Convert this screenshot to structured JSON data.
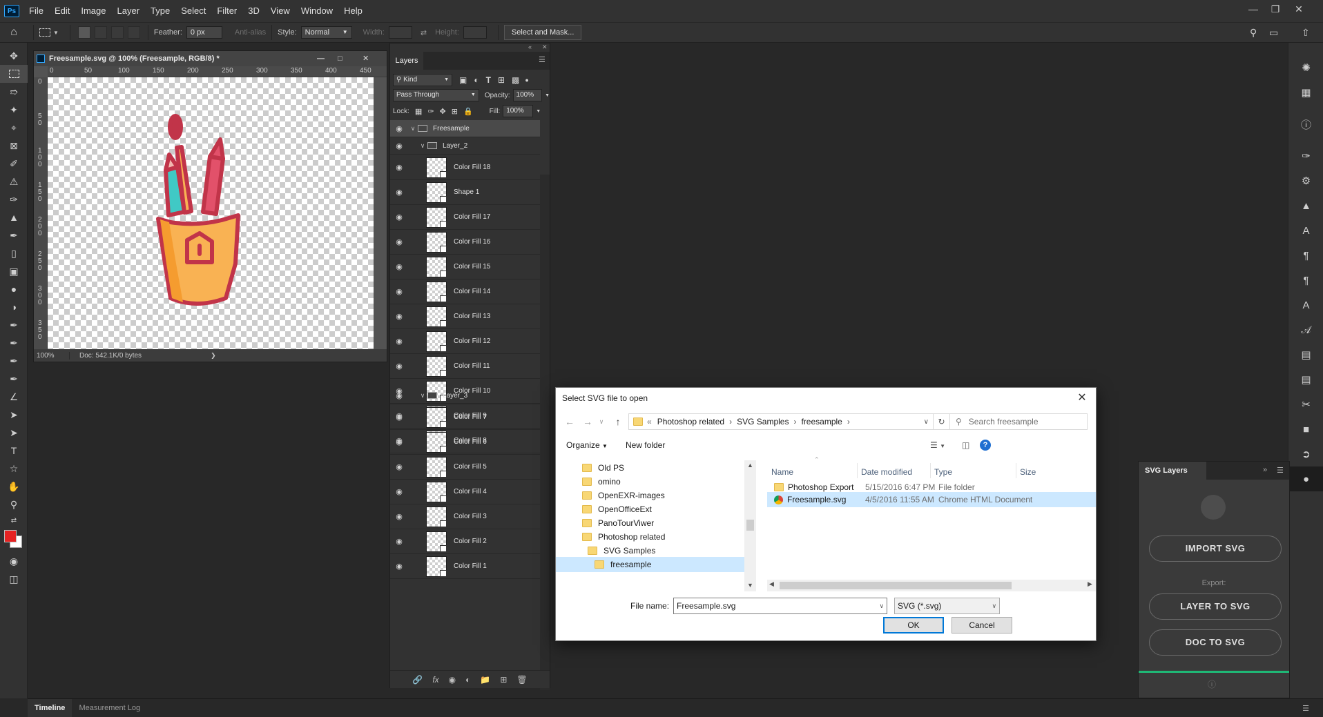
{
  "app": {
    "logo": "Ps",
    "menu": [
      "File",
      "Edit",
      "Image",
      "Layer",
      "Type",
      "Select",
      "Filter",
      "3D",
      "View",
      "Window",
      "Help"
    ]
  },
  "options": {
    "feather_label": "Feather:",
    "feather_value": "0 px",
    "antialias_label": "Anti-alias",
    "style_label": "Style:",
    "style_value": "Normal",
    "width_label": "Width:",
    "height_label": "Height:",
    "select_mask_label": "Select and Mask..."
  },
  "document": {
    "title": "Freesample.svg @ 100% (Freesample, RGB/8) *",
    "ruler_h": [
      "0",
      "50",
      "100",
      "150",
      "200",
      "250",
      "300",
      "350",
      "400",
      "450"
    ],
    "ruler_v": [
      "0",
      "5\n0",
      "1\n0\n0",
      "1\n5\n0",
      "2\n0\n0",
      "2\n5\n0",
      "3\n0\n0",
      "3\n5\n0"
    ],
    "zoom": "100%",
    "doc_info": "Doc: 542.1K/0 bytes"
  },
  "layers_panel": {
    "tab": "Layers",
    "filter_kind": "Kind",
    "blend_mode": "Pass Through",
    "opacity_label": "Opacity:",
    "opacity_value": "100%",
    "lock_label": "Lock:",
    "fill_label": "Fill:",
    "fill_value": "100%",
    "group_root": "Freesample",
    "group_1": "Layer_2",
    "group_1_layers": [
      "Color Fill 18",
      "Shape 1",
      "Color Fill 17",
      "Color Fill 16",
      "Color Fill 15",
      "Color Fill 14",
      "Color Fill 13",
      "Color Fill 12",
      "Color Fill 11",
      "Color Fill 10",
      "Color Fill 9",
      "Color Fill 8"
    ],
    "group_2": "Layer_3",
    "group_2_layers": [
      "Color Fill 7",
      "Color Fill 6",
      "Color Fill 5",
      "Color Fill 4",
      "Color Fill 3",
      "Color Fill 2",
      "Color Fill 1"
    ]
  },
  "svg_panel": {
    "tab": "SVG Layers",
    "import_label": "IMPORT SVG",
    "export_label": "Export:",
    "layer_to_svg": "LAYER TO SVG",
    "doc_to_svg": "DOC TO SVG"
  },
  "bottom": {
    "tab_timeline": "Timeline",
    "tab_measurement": "Measurement Log"
  },
  "dialog": {
    "title": "Select SVG file to open",
    "breadcrumb": [
      "Photoshop related",
      "SVG Samples",
      "freesample"
    ],
    "search_placeholder": "Search freesample",
    "organize": "Organize",
    "new_folder": "New folder",
    "tree": [
      "Old PS",
      "omino",
      "OpenEXR-images",
      "OpenOfficeExt",
      "PanoTourViwer",
      "Photoshop related",
      "SVG Samples",
      "freesample"
    ],
    "columns": [
      "Name",
      "Date modified",
      "Type",
      "Size"
    ],
    "files": [
      {
        "name": "Photoshop Export",
        "date": "5/15/2016 6:47 PM",
        "type": "File folder"
      },
      {
        "name": "Freesample.svg",
        "date": "4/5/2016 11:55 AM",
        "type": "Chrome HTML Document"
      }
    ],
    "file_name_label": "File name:",
    "file_name_value": "Freesample.svg",
    "file_type": "SVG (*.svg)",
    "ok": "OK",
    "cancel": "Cancel"
  },
  "colors": {
    "foreground": "#e52222",
    "background": "#ffffff",
    "accent_line": "#1fb876"
  }
}
